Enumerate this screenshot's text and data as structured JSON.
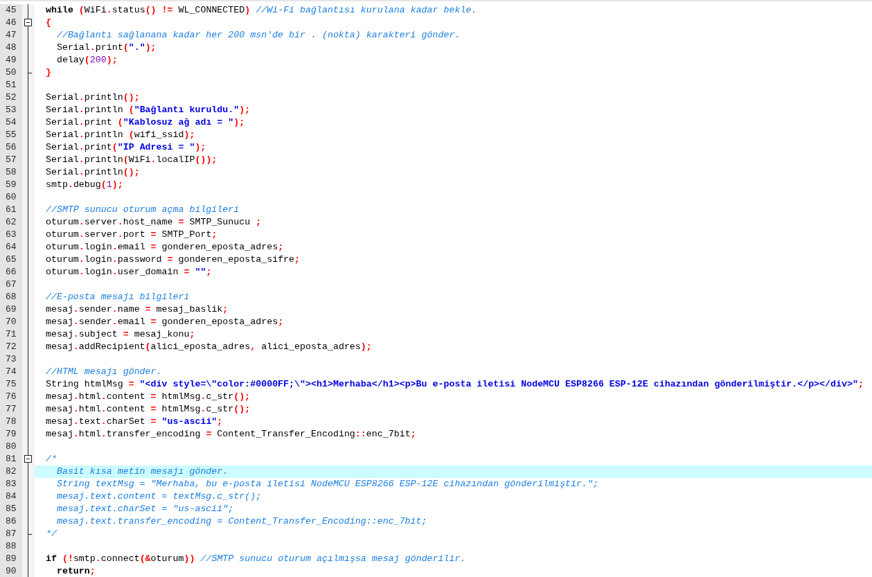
{
  "editor": {
    "lines": [
      {
        "number": "45",
        "fold_start": false,
        "fold_end": false,
        "current": false,
        "tokens": [
          {
            "kind": "kw",
            "text": "  while "
          },
          {
            "kind": "op",
            "text": "("
          },
          {
            "kind": "txt",
            "text": "WiFi"
          },
          {
            "kind": "op",
            "text": "."
          },
          {
            "kind": "txt",
            "text": "status"
          },
          {
            "kind": "op",
            "text": "() !="
          },
          {
            "kind": "txt",
            "text": " WL_CONNECTED"
          },
          {
            "kind": "op",
            "text": ")"
          },
          {
            "kind": "cmt",
            "text": " //Wi-Fi bağlantısı kurulana kadar bekle."
          }
        ]
      },
      {
        "number": "46",
        "fold_start": true,
        "fold_end": false,
        "current": false,
        "tokens": [
          {
            "kind": "op",
            "text": "  {"
          }
        ]
      },
      {
        "number": "47",
        "fold_start": false,
        "fold_end": false,
        "current": false,
        "tokens": [
          {
            "kind": "cmt",
            "text": "    //Bağlantı sağlanana kadar her 200 msn'de bir . (nokta) karakteri gönder."
          }
        ]
      },
      {
        "number": "48",
        "fold_start": false,
        "fold_end": false,
        "current": false,
        "tokens": [
          {
            "kind": "txt",
            "text": "    Serial"
          },
          {
            "kind": "op",
            "text": "."
          },
          {
            "kind": "txt",
            "text": "print"
          },
          {
            "kind": "op",
            "text": "("
          },
          {
            "kind": "str",
            "text": "\".\""
          },
          {
            "kind": "op",
            "text": ");"
          }
        ]
      },
      {
        "number": "49",
        "fold_start": false,
        "fold_end": false,
        "current": false,
        "tokens": [
          {
            "kind": "txt",
            "text": "    delay"
          },
          {
            "kind": "op",
            "text": "("
          },
          {
            "kind": "num",
            "text": "200"
          },
          {
            "kind": "op",
            "text": ");"
          }
        ]
      },
      {
        "number": "50",
        "fold_start": false,
        "fold_end": true,
        "current": false,
        "tokens": [
          {
            "kind": "op",
            "text": "  }"
          }
        ]
      },
      {
        "number": "51",
        "fold_start": false,
        "fold_end": false,
        "current": false
      },
      {
        "number": "52",
        "fold_start": false,
        "fold_end": false,
        "current": false,
        "tokens": [
          {
            "kind": "txt",
            "text": "  Serial"
          },
          {
            "kind": "op",
            "text": "."
          },
          {
            "kind": "txt",
            "text": "println"
          },
          {
            "kind": "op",
            "text": "();"
          }
        ]
      },
      {
        "number": "53",
        "fold_start": false,
        "fold_end": false,
        "current": false,
        "tokens": [
          {
            "kind": "txt",
            "text": "  Serial"
          },
          {
            "kind": "op",
            "text": "."
          },
          {
            "kind": "txt",
            "text": "println "
          },
          {
            "kind": "op",
            "text": "("
          },
          {
            "kind": "str",
            "text": "\"Bağlantı kuruldu.\""
          },
          {
            "kind": "op",
            "text": ");"
          }
        ]
      },
      {
        "number": "54",
        "fold_start": false,
        "fold_end": false,
        "current": false,
        "tokens": [
          {
            "kind": "txt",
            "text": "  Serial"
          },
          {
            "kind": "op",
            "text": "."
          },
          {
            "kind": "txt",
            "text": "print "
          },
          {
            "kind": "op",
            "text": "("
          },
          {
            "kind": "str",
            "text": "\"Kablosuz ağ adı = \""
          },
          {
            "kind": "op",
            "text": ");"
          }
        ]
      },
      {
        "number": "55",
        "fold_start": false,
        "fold_end": false,
        "current": false,
        "tokens": [
          {
            "kind": "txt",
            "text": "  Serial"
          },
          {
            "kind": "op",
            "text": "."
          },
          {
            "kind": "txt",
            "text": "println "
          },
          {
            "kind": "op",
            "text": "("
          },
          {
            "kind": "txt",
            "text": "wifi_ssid"
          },
          {
            "kind": "op",
            "text": ");"
          }
        ]
      },
      {
        "number": "56",
        "fold_start": false,
        "fold_end": false,
        "current": false,
        "tokens": [
          {
            "kind": "txt",
            "text": "  Serial"
          },
          {
            "kind": "op",
            "text": "."
          },
          {
            "kind": "txt",
            "text": "print"
          },
          {
            "kind": "op",
            "text": "("
          },
          {
            "kind": "str",
            "text": "\"IP Adresi = \""
          },
          {
            "kind": "op",
            "text": ");"
          }
        ]
      },
      {
        "number": "57",
        "fold_start": false,
        "fold_end": false,
        "current": false,
        "tokens": [
          {
            "kind": "txt",
            "text": "  Serial"
          },
          {
            "kind": "op",
            "text": "."
          },
          {
            "kind": "txt",
            "text": "println"
          },
          {
            "kind": "op",
            "text": "("
          },
          {
            "kind": "txt",
            "text": "WiFi"
          },
          {
            "kind": "op",
            "text": "."
          },
          {
            "kind": "txt",
            "text": "localIP"
          },
          {
            "kind": "op",
            "text": "());"
          }
        ]
      },
      {
        "number": "58",
        "fold_start": false,
        "fold_end": false,
        "current": false,
        "tokens": [
          {
            "kind": "txt",
            "text": "  Serial"
          },
          {
            "kind": "op",
            "text": "."
          },
          {
            "kind": "txt",
            "text": "println"
          },
          {
            "kind": "op",
            "text": "();"
          }
        ]
      },
      {
        "number": "59",
        "fold_start": false,
        "fold_end": false,
        "current": false,
        "tokens": [
          {
            "kind": "txt",
            "text": "  smtp"
          },
          {
            "kind": "op",
            "text": "."
          },
          {
            "kind": "txt",
            "text": "debug"
          },
          {
            "kind": "op",
            "text": "("
          },
          {
            "kind": "num",
            "text": "1"
          },
          {
            "kind": "op",
            "text": ");"
          }
        ]
      },
      {
        "number": "60",
        "fold_start": false,
        "fold_end": false,
        "current": false
      },
      {
        "number": "61",
        "fold_start": false,
        "fold_end": false,
        "current": false,
        "tokens": [
          {
            "kind": "cmt",
            "text": "  //SMTP sunucu oturum açma bilgileri"
          }
        ]
      },
      {
        "number": "62",
        "fold_start": false,
        "fold_end": false,
        "current": false,
        "tokens": [
          {
            "kind": "txt",
            "text": "  oturum"
          },
          {
            "kind": "op",
            "text": "."
          },
          {
            "kind": "txt",
            "text": "server"
          },
          {
            "kind": "op",
            "text": "."
          },
          {
            "kind": "txt",
            "text": "host_name "
          },
          {
            "kind": "op",
            "text": "="
          },
          {
            "kind": "txt",
            "text": " SMTP_Sunucu "
          },
          {
            "kind": "op",
            "text": ";"
          }
        ]
      },
      {
        "number": "63",
        "fold_start": false,
        "fold_end": false,
        "current": false,
        "tokens": [
          {
            "kind": "txt",
            "text": "  oturum"
          },
          {
            "kind": "op",
            "text": "."
          },
          {
            "kind": "txt",
            "text": "server"
          },
          {
            "kind": "op",
            "text": "."
          },
          {
            "kind": "txt",
            "text": "port "
          },
          {
            "kind": "op",
            "text": "="
          },
          {
            "kind": "txt",
            "text": " SMTP_Port"
          },
          {
            "kind": "op",
            "text": ";"
          }
        ]
      },
      {
        "number": "64",
        "fold_start": false,
        "fold_end": false,
        "current": false,
        "tokens": [
          {
            "kind": "txt",
            "text": "  oturum"
          },
          {
            "kind": "op",
            "text": "."
          },
          {
            "kind": "txt",
            "text": "login"
          },
          {
            "kind": "op",
            "text": "."
          },
          {
            "kind": "txt",
            "text": "email "
          },
          {
            "kind": "op",
            "text": "="
          },
          {
            "kind": "txt",
            "text": " gonderen_eposta_adres"
          },
          {
            "kind": "op",
            "text": ";"
          }
        ]
      },
      {
        "number": "65",
        "fold_start": false,
        "fold_end": false,
        "current": false,
        "tokens": [
          {
            "kind": "txt",
            "text": "  oturum"
          },
          {
            "kind": "op",
            "text": "."
          },
          {
            "kind": "txt",
            "text": "login"
          },
          {
            "kind": "op",
            "text": "."
          },
          {
            "kind": "txt",
            "text": "password "
          },
          {
            "kind": "op",
            "text": "="
          },
          {
            "kind": "txt",
            "text": " gonderen_eposta_sifre"
          },
          {
            "kind": "op",
            "text": ";"
          }
        ]
      },
      {
        "number": "66",
        "fold_start": false,
        "fold_end": false,
        "current": false,
        "tokens": [
          {
            "kind": "txt",
            "text": "  oturum"
          },
          {
            "kind": "op",
            "text": "."
          },
          {
            "kind": "txt",
            "text": "login"
          },
          {
            "kind": "op",
            "text": "."
          },
          {
            "kind": "txt",
            "text": "user_domain "
          },
          {
            "kind": "op",
            "text": "="
          },
          {
            "kind": "str",
            "text": " \"\""
          },
          {
            "kind": "op",
            "text": ";"
          }
        ]
      },
      {
        "number": "67",
        "fold_start": false,
        "fold_end": false,
        "current": false
      },
      {
        "number": "68",
        "fold_start": false,
        "fold_end": false,
        "current": false,
        "tokens": [
          {
            "kind": "cmt",
            "text": "  //E-posta mesajı bilgileri"
          }
        ]
      },
      {
        "number": "69",
        "fold_start": false,
        "fold_end": false,
        "current": false,
        "tokens": [
          {
            "kind": "txt",
            "text": "  mesaj"
          },
          {
            "kind": "op",
            "text": "."
          },
          {
            "kind": "txt",
            "text": "sender"
          },
          {
            "kind": "op",
            "text": "."
          },
          {
            "kind": "txt",
            "text": "name "
          },
          {
            "kind": "op",
            "text": "="
          },
          {
            "kind": "txt",
            "text": " mesaj_baslik"
          },
          {
            "kind": "op",
            "text": ";"
          }
        ]
      },
      {
        "number": "70",
        "fold_start": false,
        "fold_end": false,
        "current": false,
        "tokens": [
          {
            "kind": "txt",
            "text": "  mesaj"
          },
          {
            "kind": "op",
            "text": "."
          },
          {
            "kind": "txt",
            "text": "sender"
          },
          {
            "kind": "op",
            "text": "."
          },
          {
            "kind": "txt",
            "text": "email "
          },
          {
            "kind": "op",
            "text": "="
          },
          {
            "kind": "txt",
            "text": " gonderen_eposta_adres"
          },
          {
            "kind": "op",
            "text": ";"
          }
        ]
      },
      {
        "number": "71",
        "fold_start": false,
        "fold_end": false,
        "current": false,
        "tokens": [
          {
            "kind": "txt",
            "text": "  mesaj"
          },
          {
            "kind": "op",
            "text": "."
          },
          {
            "kind": "txt",
            "text": "subject "
          },
          {
            "kind": "op",
            "text": "="
          },
          {
            "kind": "txt",
            "text": " mesaj_konu"
          },
          {
            "kind": "op",
            "text": ";"
          }
        ]
      },
      {
        "number": "72",
        "fold_start": false,
        "fold_end": false,
        "current": false,
        "tokens": [
          {
            "kind": "txt",
            "text": "  mesaj"
          },
          {
            "kind": "op",
            "text": "."
          },
          {
            "kind": "txt",
            "text": "addRecipient"
          },
          {
            "kind": "op",
            "text": "("
          },
          {
            "kind": "txt",
            "text": "alici_eposta_adres"
          },
          {
            "kind": "op",
            "text": ","
          },
          {
            "kind": "txt",
            "text": " alici_eposta_adres"
          },
          {
            "kind": "op",
            "text": ");"
          }
        ]
      },
      {
        "number": "73",
        "fold_start": false,
        "fold_end": false,
        "current": false
      },
      {
        "number": "74",
        "fold_start": false,
        "fold_end": false,
        "current": false,
        "tokens": [
          {
            "kind": "cmt",
            "text": "  //HTML mesajı gönder."
          }
        ]
      },
      {
        "number": "75",
        "fold_start": false,
        "fold_end": false,
        "current": false,
        "tokens": [
          {
            "kind": "txt",
            "text": "  String htmlMsg "
          },
          {
            "kind": "op",
            "text": "="
          },
          {
            "kind": "str",
            "text": " \"<div style=\\\"color:#0000FF;\\\"><h1>Merhaba</h1><p>Bu e-posta iletisi NodeMCU ESP8266 ESP-12E cihazından gönderilmiştir.</p></div>\""
          },
          {
            "kind": "op",
            "text": ";"
          }
        ]
      },
      {
        "number": "76",
        "fold_start": false,
        "fold_end": false,
        "current": false,
        "tokens": [
          {
            "kind": "txt",
            "text": "  mesaj"
          },
          {
            "kind": "op",
            "text": "."
          },
          {
            "kind": "txt",
            "text": "html"
          },
          {
            "kind": "op",
            "text": "."
          },
          {
            "kind": "txt",
            "text": "content "
          },
          {
            "kind": "op",
            "text": "="
          },
          {
            "kind": "txt",
            "text": " htmlMsg"
          },
          {
            "kind": "op",
            "text": "."
          },
          {
            "kind": "txt",
            "text": "c_str"
          },
          {
            "kind": "op",
            "text": "();"
          }
        ]
      },
      {
        "number": "77",
        "fold_start": false,
        "fold_end": false,
        "current": false,
        "tokens": [
          {
            "kind": "txt",
            "text": "  mesaj"
          },
          {
            "kind": "op",
            "text": "."
          },
          {
            "kind": "txt",
            "text": "html"
          },
          {
            "kind": "op",
            "text": "."
          },
          {
            "kind": "txt",
            "text": "content "
          },
          {
            "kind": "op",
            "text": "="
          },
          {
            "kind": "txt",
            "text": " htmlMsg"
          },
          {
            "kind": "op",
            "text": "."
          },
          {
            "kind": "txt",
            "text": "c_str"
          },
          {
            "kind": "op",
            "text": "();"
          }
        ]
      },
      {
        "number": "78",
        "fold_start": false,
        "fold_end": false,
        "current": false,
        "tokens": [
          {
            "kind": "txt",
            "text": "  mesaj"
          },
          {
            "kind": "op",
            "text": "."
          },
          {
            "kind": "txt",
            "text": "text"
          },
          {
            "kind": "op",
            "text": "."
          },
          {
            "kind": "txt",
            "text": "charSet "
          },
          {
            "kind": "op",
            "text": "="
          },
          {
            "kind": "str",
            "text": " \"us-ascii\""
          },
          {
            "kind": "op",
            "text": ";"
          }
        ]
      },
      {
        "number": "79",
        "fold_start": false,
        "fold_end": false,
        "current": false,
        "tokens": [
          {
            "kind": "txt",
            "text": "  mesaj"
          },
          {
            "kind": "op",
            "text": "."
          },
          {
            "kind": "txt",
            "text": "html"
          },
          {
            "kind": "op",
            "text": "."
          },
          {
            "kind": "txt",
            "text": "transfer_encoding "
          },
          {
            "kind": "op",
            "text": "="
          },
          {
            "kind": "txt",
            "text": " Content_Transfer_Encoding"
          },
          {
            "kind": "op",
            "text": "::"
          },
          {
            "kind": "txt",
            "text": "enc_7bit"
          },
          {
            "kind": "op",
            "text": ";"
          }
        ]
      },
      {
        "number": "80",
        "fold_start": false,
        "fold_end": false,
        "current": false
      },
      {
        "number": "81",
        "fold_start": true,
        "fold_end": false,
        "current": false,
        "tokens": [
          {
            "kind": "cmt",
            "text": "  /*"
          }
        ]
      },
      {
        "number": "82",
        "fold_start": false,
        "fold_end": false,
        "current": true,
        "tokens": [
          {
            "kind": "cmt",
            "text": "    Basit kısa metin mesajı gönder."
          }
        ]
      },
      {
        "number": "83",
        "fold_start": false,
        "fold_end": false,
        "current": false,
        "tokens": [
          {
            "kind": "cmt",
            "text": "    String textMsg = \"Merhaba, bu e-posta iletisi NodeMCU ESP8266 ESP-12E cihazından gönderilmiştir.\";"
          }
        ]
      },
      {
        "number": "84",
        "fold_start": false,
        "fold_end": false,
        "current": false,
        "tokens": [
          {
            "kind": "cmt",
            "text": "    mesaj.text.content = textMsg.c_str();"
          }
        ]
      },
      {
        "number": "85",
        "fold_start": false,
        "fold_end": false,
        "current": false,
        "tokens": [
          {
            "kind": "cmt",
            "text": "    mesaj.text.charSet = \"us-ascii\";"
          }
        ]
      },
      {
        "number": "86",
        "fold_start": false,
        "fold_end": false,
        "current": false,
        "tokens": [
          {
            "kind": "cmt",
            "text": "    mesaj.text.transfer_encoding = Content_Transfer_Encoding::enc_7bit;"
          }
        ]
      },
      {
        "number": "87",
        "fold_start": false,
        "fold_end": true,
        "current": false,
        "tokens": [
          {
            "kind": "cmt",
            "text": "  */"
          }
        ]
      },
      {
        "number": "88",
        "fold_start": false,
        "fold_end": false,
        "current": false
      },
      {
        "number": "89",
        "fold_start": false,
        "fold_end": false,
        "current": false,
        "tokens": [
          {
            "kind": "kw",
            "text": "  if "
          },
          {
            "kind": "op",
            "text": "(!"
          },
          {
            "kind": "txt",
            "text": "smtp"
          },
          {
            "kind": "op",
            "text": "."
          },
          {
            "kind": "txt",
            "text": "connect"
          },
          {
            "kind": "op",
            "text": "(&"
          },
          {
            "kind": "txt",
            "text": "oturum"
          },
          {
            "kind": "op",
            "text": "))"
          },
          {
            "kind": "cmt",
            "text": " //SMTP sunucu oturum açılmışsa mesaj gönderilir."
          }
        ]
      },
      {
        "number": "90",
        "fold_start": false,
        "fold_end": false,
        "current": false,
        "tokens": [
          {
            "kind": "kw",
            "text": "    return"
          },
          {
            "kind": "op",
            "text": ";"
          }
        ]
      }
    ]
  }
}
